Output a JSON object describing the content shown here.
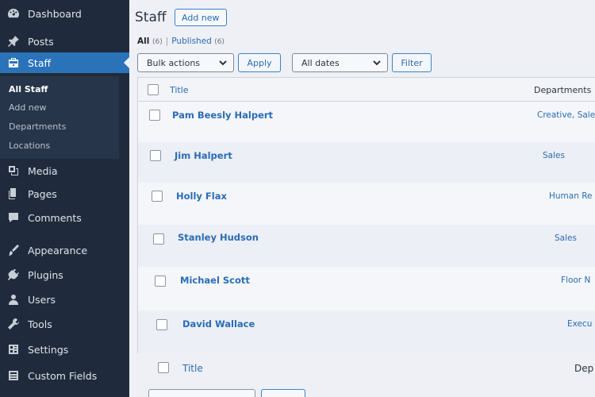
{
  "sidebar": {
    "items": [
      {
        "label": "Dashboard",
        "icon": "dashboard-icon"
      },
      {
        "label": "Posts",
        "icon": "pin-icon"
      },
      {
        "label": "Staff",
        "icon": "staff-icon",
        "active": true
      },
      {
        "label": "Media",
        "icon": "media-icon"
      },
      {
        "label": "Pages",
        "icon": "pages-icon"
      },
      {
        "label": "Comments",
        "icon": "comments-icon"
      },
      {
        "label": "Appearance",
        "icon": "appearance-icon"
      },
      {
        "label": "Plugins",
        "icon": "plugins-icon"
      },
      {
        "label": "Users",
        "icon": "users-icon"
      },
      {
        "label": "Tools",
        "icon": "tools-icon"
      },
      {
        "label": "Settings",
        "icon": "settings-icon"
      },
      {
        "label": "Custom Fields",
        "icon": "custom-fields-icon"
      }
    ],
    "submenu": [
      "All Staff",
      "Add new",
      "Departments",
      "Locations"
    ]
  },
  "header": {
    "title": "Staff",
    "add_new": "Add new"
  },
  "views": {
    "all_label": "All",
    "all_count": "(6)",
    "separator": "|",
    "published_label": "Published",
    "published_count": "(6)"
  },
  "toolbar": {
    "bulk_actions": "Bulk actions",
    "apply": "Apply",
    "dates": "All dates",
    "filter": "Filter"
  },
  "table": {
    "columns": {
      "title": "Title",
      "departments": "Departments"
    },
    "footer_columns": {
      "title": "Title",
      "departments": "Dep"
    },
    "rows": [
      {
        "title": "Pam Beesly Halpert",
        "department": "Creative, Sales"
      },
      {
        "title": "Jim Halpert",
        "department": "Sales"
      },
      {
        "title": "Holly Flax",
        "department": "Human Re"
      },
      {
        "title": "Stanley Hudson",
        "department": "Sales"
      },
      {
        "title": "Michael Scott",
        "department": "Floor N"
      },
      {
        "title": "David Wallace",
        "department": "Execu"
      }
    ]
  },
  "colors": {
    "sidebar_bg": "#1f2b3c",
    "accent": "#2a73b9",
    "link": "#2a6cb5",
    "page_bg": "#eef0f5"
  }
}
